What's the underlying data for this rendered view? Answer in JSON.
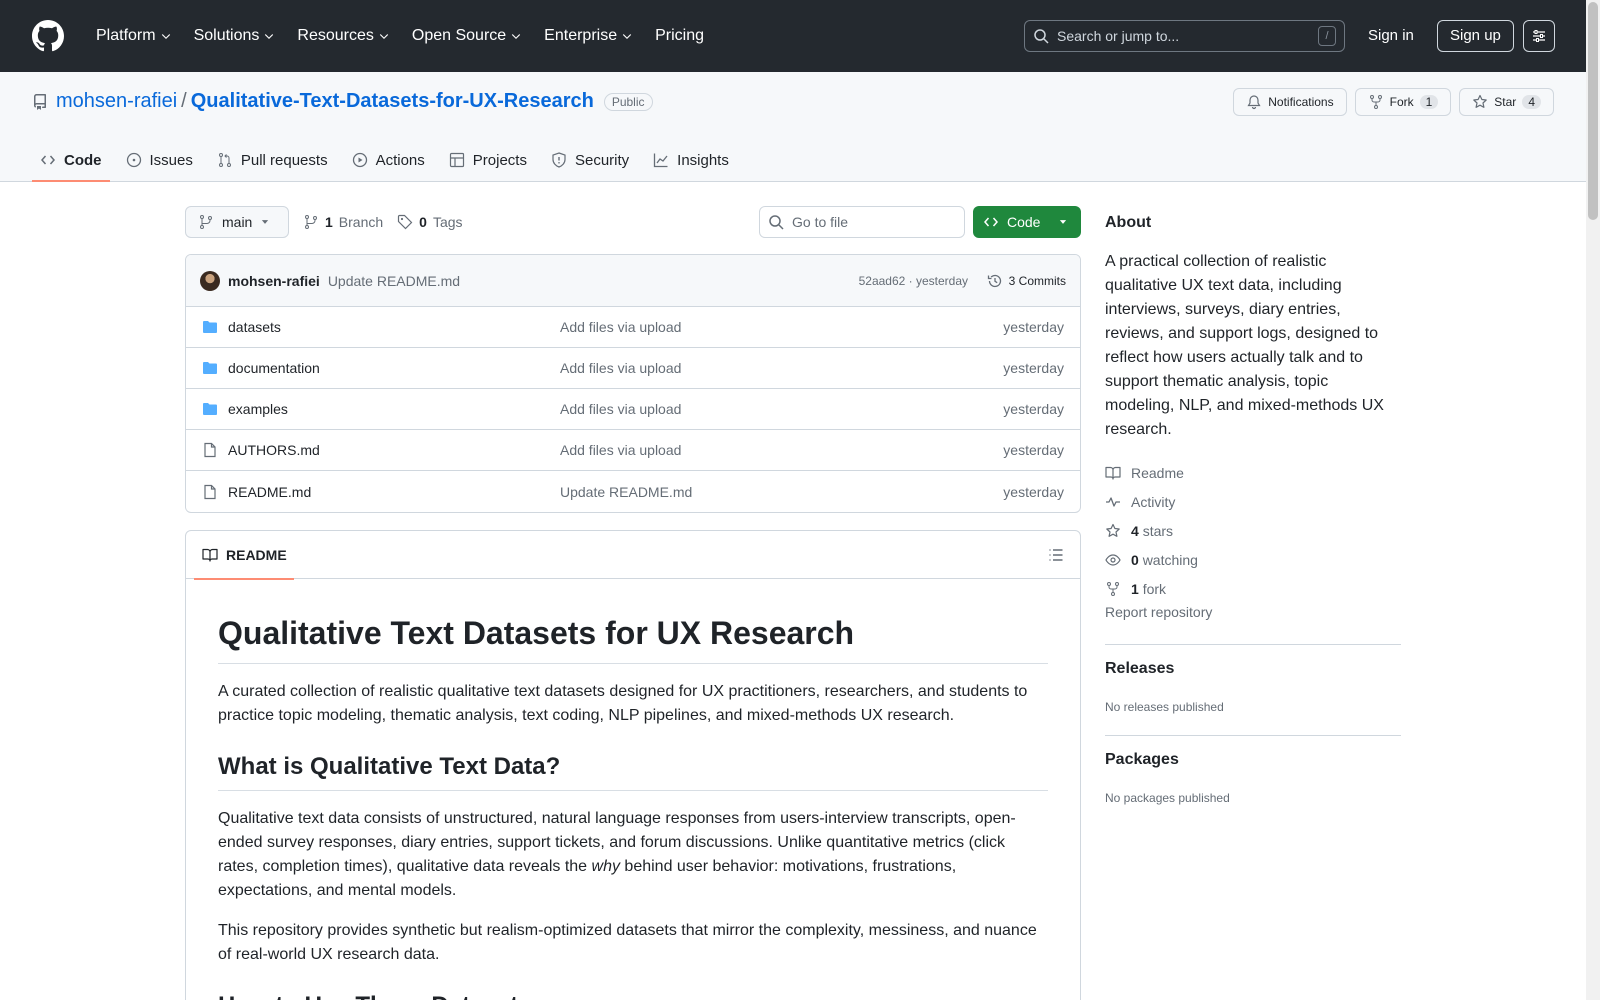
{
  "header": {
    "nav": [
      {
        "label": "Platform",
        "dropdown": true
      },
      {
        "label": "Solutions",
        "dropdown": true
      },
      {
        "label": "Resources",
        "dropdown": true
      },
      {
        "label": "Open Source",
        "dropdown": true
      },
      {
        "label": "Enterprise",
        "dropdown": true
      },
      {
        "label": "Pricing",
        "dropdown": false
      }
    ],
    "search_placeholder": "Search or jump to...",
    "search_shortcut": "/",
    "sign_in": "Sign in",
    "sign_up": "Sign up"
  },
  "repo": {
    "owner": "mohsen-rafiei",
    "separator": "/",
    "name": "Qualitative-Text-Datasets-for-UX-Research",
    "visibility": "Public",
    "actions": {
      "notifications": "Notifications",
      "fork": "Fork",
      "fork_count": "1",
      "star": "Star",
      "star_count": "4"
    },
    "tabs": [
      {
        "label": "Code",
        "icon": "code-icon",
        "active": true
      },
      {
        "label": "Issues",
        "icon": "issue-icon",
        "active": false
      },
      {
        "label": "Pull requests",
        "icon": "pull-request-icon",
        "active": false
      },
      {
        "label": "Actions",
        "icon": "play-icon",
        "active": false
      },
      {
        "label": "Projects",
        "icon": "table-icon",
        "active": false
      },
      {
        "label": "Security",
        "icon": "shield-icon",
        "active": false
      },
      {
        "label": "Insights",
        "icon": "graph-icon",
        "active": false
      }
    ]
  },
  "filenav": {
    "branch": "main",
    "branch_count": "1",
    "branch_label": "Branch",
    "tag_count": "0",
    "tag_label": "Tags",
    "goto_placeholder": "Go to file",
    "code_button": "Code"
  },
  "commit": {
    "author": "mohsen-rafiei",
    "message": "Update README.md",
    "meta": "52aad62 · yesterday",
    "commits": "3 Commits"
  },
  "files": [
    {
      "name": "datasets",
      "type": "folder",
      "message": "Add files via upload",
      "date": "yesterday"
    },
    {
      "name": "documentation",
      "type": "folder",
      "message": "Add files via upload",
      "date": "yesterday"
    },
    {
      "name": "examples",
      "type": "folder",
      "message": "Add files via upload",
      "date": "yesterday"
    },
    {
      "name": "AUTHORS.md",
      "type": "file",
      "message": "Add files via upload",
      "date": "yesterday"
    },
    {
      "name": "README.md",
      "type": "file",
      "message": "Update README.md",
      "date": "yesterday"
    }
  ],
  "readme": {
    "tab_label": "README",
    "h1": "Qualitative Text Datasets for UX Research",
    "intro": "A curated collection of realistic qualitative text datasets designed for UX practitioners, researchers, and students to practice topic modeling, thematic analysis, text coding, NLP pipelines, and mixed-methods UX research.",
    "h2_1": "What is Qualitative Text Data?",
    "p1_before": "Qualitative text data consists of unstructured, natural language responses from users-interview transcripts, open-ended survey responses, diary entries, support tickets, and forum discussions. Unlike quantitative metrics (click rates, completion times), qualitative data reveals the ",
    "p1_em": "why",
    "p1_after": " behind user behavior: motivations, frustrations, expectations, and mental models.",
    "p2": "This repository provides synthetic but realism-optimized datasets that mirror the complexity, messiness, and nuance of real-world UX research data.",
    "h2_2": "How to Use These Datasets"
  },
  "sidebar": {
    "about_title": "About",
    "description": "A practical collection of realistic qualitative UX text data, including interviews, surveys, diary entries, reviews, and support logs, designed to reflect how users actually talk and to support thematic analysis, topic modeling, NLP, and mixed-methods UX research.",
    "readme": "Readme",
    "activity": "Activity",
    "stars_count": "4",
    "stars_label": "stars",
    "watching_count": "0",
    "watching_label": "watching",
    "fork_count": "1",
    "fork_label": "fork",
    "report": "Report repository",
    "releases_title": "Releases",
    "releases_none": "No releases published",
    "packages_title": "Packages",
    "packages_none": "No packages published"
  },
  "colors": {
    "header_bg": "#24292f",
    "link": "#0969da",
    "primary_button": "#1f883d",
    "active_tab_underline": "#fd8c73",
    "folder": "#54aeff"
  }
}
